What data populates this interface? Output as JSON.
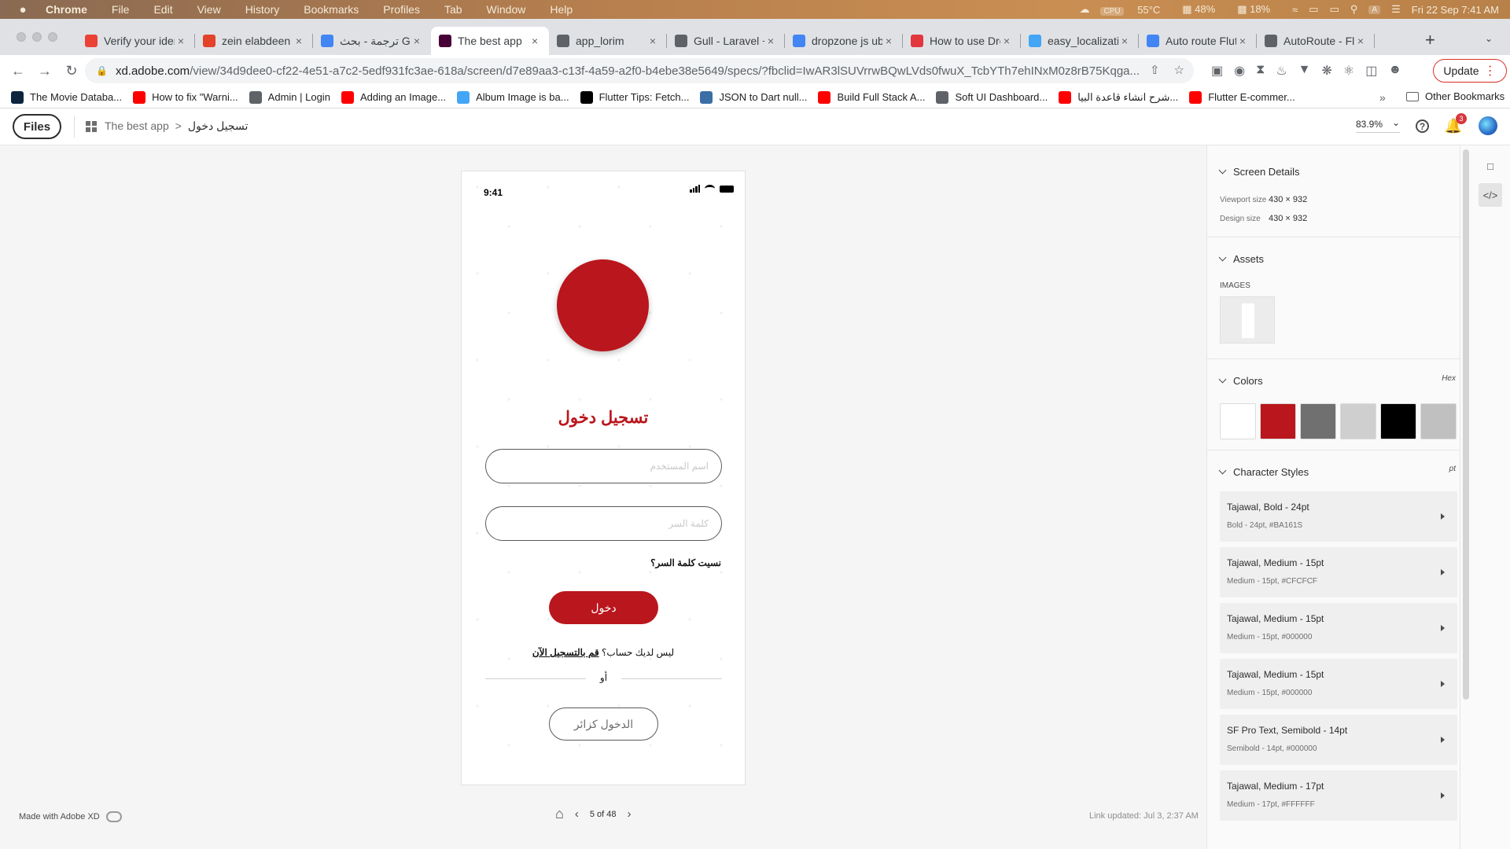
{
  "menubar": {
    "items": [
      "Chrome",
      "File",
      "Edit",
      "View",
      "History",
      "Bookmarks",
      "Profiles",
      "Tab",
      "Window",
      "Help"
    ],
    "status": {
      "cpu_label": "CPU",
      "temp": "55°C",
      "mem": "48%",
      "disk": "18%",
      "keyboard": "A",
      "datetime": "Fri 22 Sep  7:41 AM"
    }
  },
  "tabs": [
    {
      "title": "Verify your ident",
      "icon": "gmail-icon",
      "color": "#ea4335"
    },
    {
      "title": "zein elabdeen / ",
      "icon": "gitlab-icon",
      "color": "#e24329"
    },
    {
      "title": "ترجمة - بحث Google",
      "icon": "google-icon",
      "color": "#4285f4"
    },
    {
      "title": "The best app",
      "icon": "adobe-xd-icon",
      "color": "#470137",
      "active": true
    },
    {
      "title": "app_lorim",
      "icon": "globe-icon",
      "color": "#5f6368"
    },
    {
      "title": "Gull - Laravel +",
      "icon": "globe-icon",
      "color": "#5f6368"
    },
    {
      "title": "dropzone js ubl",
      "icon": "google-icon",
      "color": "#4285f4"
    },
    {
      "title": "How to use Drop",
      "icon": "tutorial-icon",
      "color": "#e2373f"
    },
    {
      "title": "easy_localizatio",
      "icon": "flutter-icon",
      "color": "#42a5f5"
    },
    {
      "title": "Auto route Flutt",
      "icon": "google-icon",
      "color": "#4285f4"
    },
    {
      "title": "AutoRoute - Flu",
      "icon": "autoroute-icon",
      "color": "#5f6368"
    }
  ],
  "address_bar": {
    "host": "xd.adobe.com",
    "path": "/view/34d9dee0-cf22-4e51-a7c2-5edf931fc3ae-618a/screen/d7e89aa3-c13f-4a59-a2f0-b4ebe38e5649/specs/?fbclid=IwAR3lSUVrrwBQwLVds0fwuX_TcbYTh7ehINxM0z8rB75Kqga..."
  },
  "update_button": "Update",
  "bookmarks": [
    {
      "label": "The Movie Databa...",
      "color": "#0d253f"
    },
    {
      "label": "How to fix \"Warni...",
      "color": "#ff0000"
    },
    {
      "label": "Admin | Login",
      "color": "#5f6368"
    },
    {
      "label": "Adding an Image...",
      "color": "#ff0000"
    },
    {
      "label": "Album Image is ba...",
      "color": "#42a5f5"
    },
    {
      "label": "Flutter Tips: Fetch...",
      "color": "#000000"
    },
    {
      "label": "JSON to Dart null...",
      "color": "#3b6ea5"
    },
    {
      "label": "Build Full Stack A...",
      "color": "#ff0000"
    },
    {
      "label": "Soft UI Dashboard...",
      "color": "#5f6368"
    },
    {
      "label": "شرح انشاء قاعدة البيا...",
      "color": "#ff0000"
    },
    {
      "label": "Flutter E-commer...",
      "color": "#ff0000"
    }
  ],
  "other_bookmarks": "Other Bookmarks",
  "xd_header": {
    "files_button": "Files",
    "breadcrumb_project": "The best app",
    "breadcrumb_separator": ">",
    "breadcrumb_screen": "تسجيل دخول",
    "zoom": "83.9%",
    "notification_count": "3"
  },
  "artboard": {
    "status_time": "9:41",
    "title": "تسجيل دخول",
    "username_placeholder": "اسم المستخدم",
    "password_placeholder": "كلمة السر",
    "forgot_password": "نسيت كلمة السر؟",
    "login_button": "دخول",
    "signup_prompt": "ليس لديك حساب؟",
    "signup_link": "قم بالتسجيل الآن",
    "or": "أو",
    "guest_button": "الدخول كزائر",
    "brand_color": "#BA161D"
  },
  "footer": {
    "made_with": "Made with Adobe XD",
    "page_indicator": "5 of 48",
    "link_updated": "Link updated: Jul 3, 2:37 AM"
  },
  "panel": {
    "screen_details": {
      "title": "Screen Details",
      "viewport_label": "Viewport size",
      "viewport_value": "430 × 932",
      "design_label": "Design size",
      "design_value": "430 × 932"
    },
    "assets": {
      "title": "Assets",
      "images_label": "IMAGES"
    },
    "colors": {
      "title": "Colors",
      "format": "Hex",
      "swatches": [
        "#FFFFFF",
        "#BA161D",
        "#707070",
        "#CFCFCF",
        "#000000",
        "#C0C0C0"
      ]
    },
    "character_styles": {
      "title": "Character Styles",
      "unit": "pt",
      "items": [
        {
          "name": "Tajawal, Bold - 24pt",
          "detail": "Bold - 24pt, #BA161S"
        },
        {
          "name": "Tajawal, Medium - 15pt",
          "detail": "Medium - 15pt, #CFCFCF"
        },
        {
          "name": "Tajawal, Medium - 15pt",
          "detail": "Medium - 15pt, #000000"
        },
        {
          "name": "Tajawal, Medium - 15pt",
          "detail": "Medium - 15pt, #000000"
        },
        {
          "name": "SF Pro Text, Semibold - 14pt",
          "detail": "Semibold - 14pt, #000000"
        },
        {
          "name": "Tajawal, Medium - 17pt",
          "detail": "Medium - 17pt, #FFFFFF"
        }
      ]
    }
  }
}
